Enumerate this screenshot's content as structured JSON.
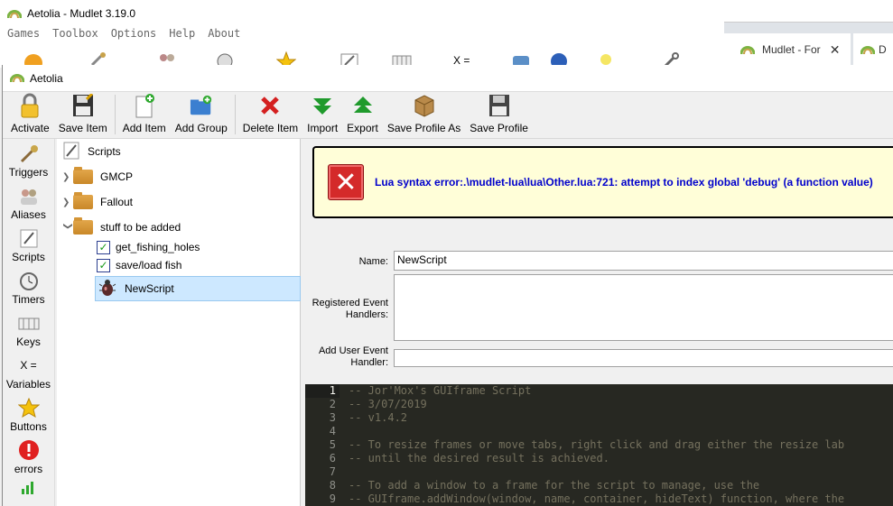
{
  "bg_window": {
    "title": "Aetolia - Mudlet 3.19.0",
    "menu": [
      "Games",
      "Toolbox",
      "Options",
      "Help",
      "About"
    ],
    "toolbar_icons": [
      "lightning-icon",
      "tools-icon",
      "people-icon",
      "timer-icon",
      "star-icon",
      "pencil-icon",
      "keys-icon",
      "variables-icon",
      "phone-icon",
      "globe-icon",
      "bulb-icon",
      "wrench-icon"
    ]
  },
  "browser_tabs": [
    {
      "label": "Mudlet - For"
    },
    {
      "label": "D"
    }
  ],
  "editor": {
    "title": "Aetolia",
    "toolbar": {
      "activate": "Activate",
      "save_item": "Save Item",
      "add_item": "Add Item",
      "add_group": "Add Group",
      "delete_item": "Delete Item",
      "import": "Import",
      "export": "Export",
      "save_profile_as": "Save Profile As",
      "save_profile": "Save Profile"
    },
    "sidebar": {
      "items": [
        {
          "label": "Triggers",
          "icon": "triggers-icon"
        },
        {
          "label": "Aliases",
          "icon": "aliases-icon"
        },
        {
          "label": "Scripts",
          "icon": "scripts-icon"
        },
        {
          "label": "Timers",
          "icon": "timers-icon"
        },
        {
          "label": "Keys",
          "icon": "keys-icon"
        },
        {
          "label": "Variables",
          "icon": "variables-icon"
        },
        {
          "label": "Buttons",
          "icon": "buttons-icon"
        },
        {
          "label": "errors",
          "icon": "errors-icon"
        }
      ],
      "variables_glyph": "X ="
    },
    "tree": {
      "root": "Scripts",
      "folders": [
        "GMCP",
        "Fallout",
        "stuff to be added"
      ],
      "children": [
        "get_fishing_holes",
        "save/load fish",
        "NewScript"
      ]
    },
    "error": {
      "message": "Lua syntax error:.\\mudlet-lua\\lua\\Other.lua:721: attempt to index global 'debug' (a function value)"
    },
    "form": {
      "name_label": "Name:",
      "name_value": "NewScript",
      "registered_label": "Registered Event Handlers:",
      "add_user_label": "Add User Event Handler:"
    },
    "code": {
      "lines": [
        "-- Jor'Mox's GUIframe Script",
        "-- 3/07/2019",
        "-- v1.4.2",
        "",
        "-- To resize frames or move tabs, right click and drag either the resize lab",
        "-- until the desired result is achieved.",
        "",
        "-- To add a window to a frame for the script to manage, use the",
        "-- GUIframe.addWindow(window, name, container, hideText) function, where the"
      ],
      "line_numbers": [
        "1",
        "2",
        "3",
        "4",
        "5",
        "6",
        "7",
        "8",
        "9"
      ]
    },
    "colors": {
      "error_text": "#0000cc",
      "error_bg": "#fffed8",
      "code_bg": "#272822",
      "code_comment": "#75715e",
      "selected_row": "#cde8ff"
    }
  }
}
